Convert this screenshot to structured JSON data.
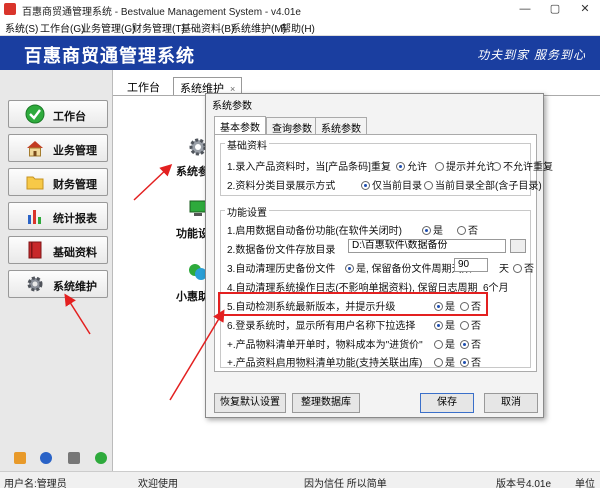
{
  "window": {
    "title": "百惠商贸通管理系统 - Bestvalue Management System - v4.01e",
    "minimize": "—",
    "maximize": "▢",
    "close": "✕"
  },
  "menu": [
    "系统(S)",
    "工作台(G)",
    "业务管理(G)",
    "财务管理(T)",
    "基础资料(B)",
    "系统维护(M)",
    "帮助(H)"
  ],
  "banner": {
    "brand": "百惠商贸通管理系统",
    "slogan": "功夫到家 服务到心"
  },
  "sidebar": {
    "items": [
      {
        "label": "工作台",
        "icon": "check-circle-icon"
      },
      {
        "label": "业务管理",
        "icon": "house-icon"
      },
      {
        "label": "财务管理",
        "icon": "folder-icon"
      },
      {
        "label": "统计报表",
        "icon": "bar-chart-icon"
      },
      {
        "label": "基础资料",
        "icon": "book-icon"
      },
      {
        "label": "系统维护",
        "icon": "gear-icon"
      }
    ]
  },
  "content": {
    "tabs": [
      {
        "label": "工作台"
      },
      {
        "label": "系统维护",
        "close": "×"
      }
    ],
    "tools": [
      {
        "label": "系统参数",
        "icon": "gears-icon"
      },
      {
        "label": "功能设置",
        "icon": "computer-icon"
      },
      {
        "label": "小惠助理",
        "icon": "chat-icon"
      }
    ]
  },
  "dialog": {
    "title": "系统参数",
    "tabs": [
      "基本参数",
      "查询参数",
      "系统参数"
    ],
    "group1": {
      "title": "基础资料",
      "row1": {
        "label": "1.录入产品资料时，当[产品条码]重复",
        "opts": [
          "允许",
          "提示并允许",
          "不允许重复"
        ]
      },
      "row2": {
        "label": "2.资料分类目录展示方式",
        "opts": [
          "仅当前目录",
          "当前目录全部(含子目录)"
        ]
      }
    },
    "group2": {
      "title": "功能设置",
      "row1": {
        "label": "1.启用数据自动备份功能(在软件关闭时)",
        "yes": "是",
        "no": "否"
      },
      "row2": {
        "label": "2.数据备份文件存放目录",
        "path": "D:\\百惠软件\\数据备份"
      },
      "row3": {
        "label": "3.自动清理历史备份文件",
        "yes": "是, 保留备份文件周期天数",
        "days": "90",
        "unit": "天",
        "no": "否"
      },
      "row4": {
        "label": "4.自动清理系统操作日志(不影响单据资料), 保留日志周期",
        "value": "6个月"
      },
      "row5": {
        "label": "5.自动检测系统最新版本，并提示升级",
        "yes": "是",
        "no": "否"
      },
      "row6": {
        "label": "6.登录系统时，显示所有用户名称下拉选择",
        "yes": "是",
        "no": "否"
      },
      "row7": {
        "label": "+.产品物料清单开单时，物料成本为\"进货价\"",
        "yes": "是",
        "no": "否"
      },
      "row8": {
        "label": "+.产品资料启用物料清单功能(支持关联出库)",
        "yes": "是",
        "no": "否"
      }
    },
    "buttons": {
      "reset": "恢复默认设置",
      "cleanup": "整理数据库",
      "save": "保存",
      "cancel": "取消"
    }
  },
  "status": {
    "user": "用户名:管理员",
    "welcome": "欢迎使用",
    "motto": "因为信任 所以简单",
    "version": "版本号4.01e",
    "unit": "单位"
  },
  "colors": {
    "banner": "#1a3ea0",
    "annotation": "#e32020"
  }
}
